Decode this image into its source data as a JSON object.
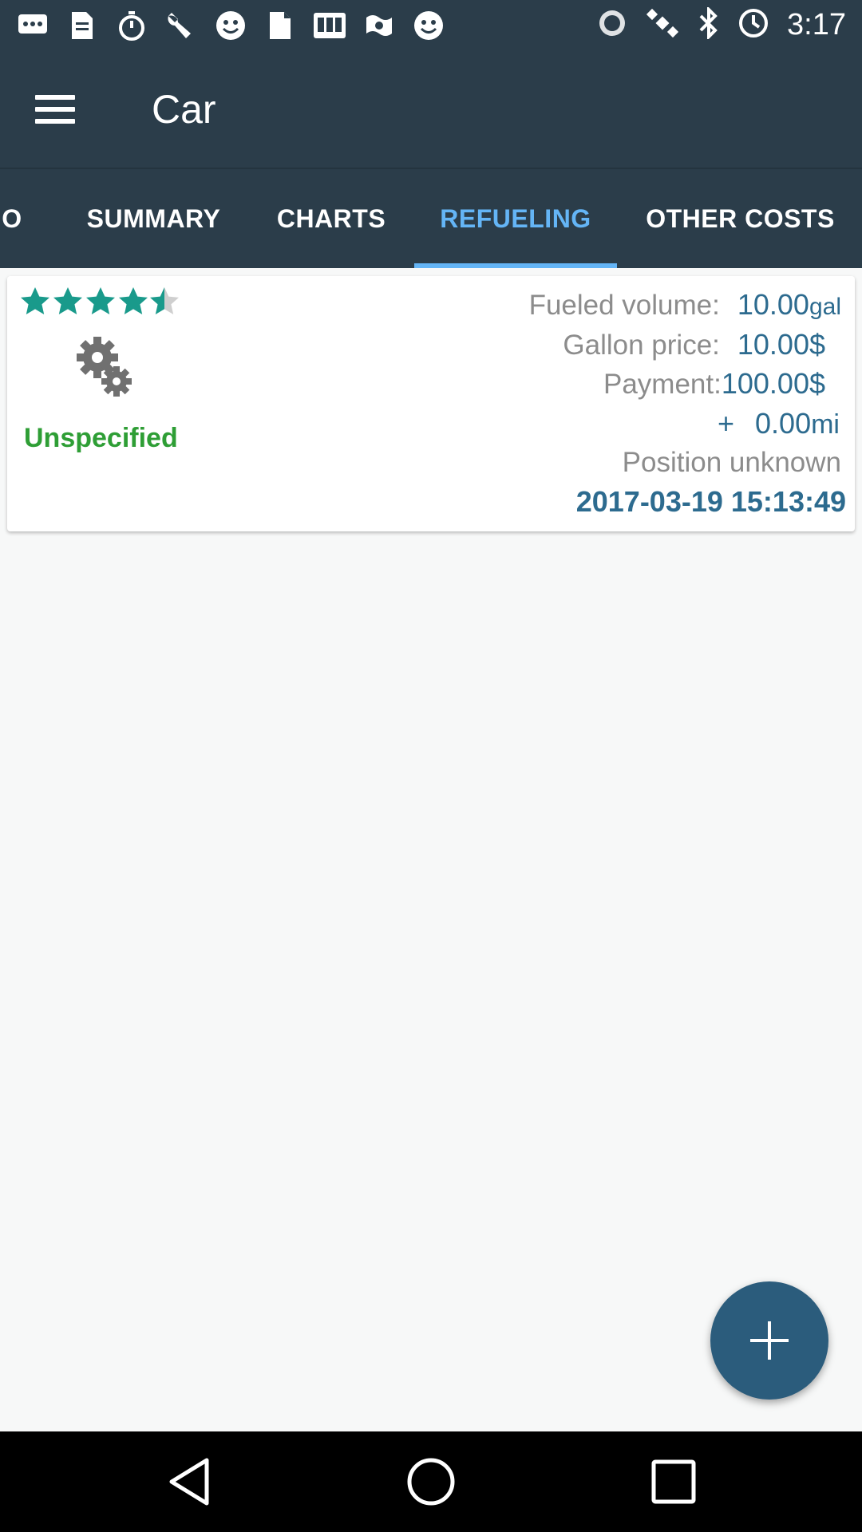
{
  "status_bar": {
    "time": "3:17",
    "left_icons": [
      "messages-icon",
      "document-icon",
      "stopwatch-icon",
      "wrench-icon",
      "smiley-icon",
      "document-icon",
      "qr-icon",
      "dollar-icon",
      "smiley-icon"
    ],
    "right_icons": [
      "alarm-icon",
      "satellite-icon",
      "bluetooth-icon",
      "timer-icon"
    ]
  },
  "app_bar": {
    "title": "Car"
  },
  "tabs": [
    {
      "label": "O",
      "active": false
    },
    {
      "label": "SUMMARY",
      "active": false
    },
    {
      "label": "CHARTS",
      "active": false
    },
    {
      "label": "REFUELING",
      "active": true
    },
    {
      "label": "OTHER COSTS",
      "active": false
    }
  ],
  "refueling_entry": {
    "rating": 4.5,
    "rating_max": 5,
    "category": "Unspecified",
    "fueled_volume_label": "Fueled volume:",
    "fueled_volume_value": "10.00",
    "fueled_volume_unit": "gal",
    "gallon_price_label": "Gallon price:",
    "gallon_price_value": "10.00$",
    "payment_label": "Payment:",
    "payment_value": "100.00$",
    "distance_prefix": "+",
    "distance_value": "0.00",
    "distance_unit": "mi",
    "position": "Position unknown",
    "datetime": "2017-03-19 15:13:49"
  },
  "colors": {
    "toolbar": "#2b3d4a",
    "accent": "#64b5f6",
    "value": "#2d6b8f",
    "category": "#2e9e35",
    "star": "#199a8b",
    "fab": "#2b5c7c"
  },
  "fab": {
    "icon": "plus-icon"
  },
  "nav_bar": {
    "icons": [
      "back-icon",
      "home-icon",
      "recents-icon"
    ]
  }
}
